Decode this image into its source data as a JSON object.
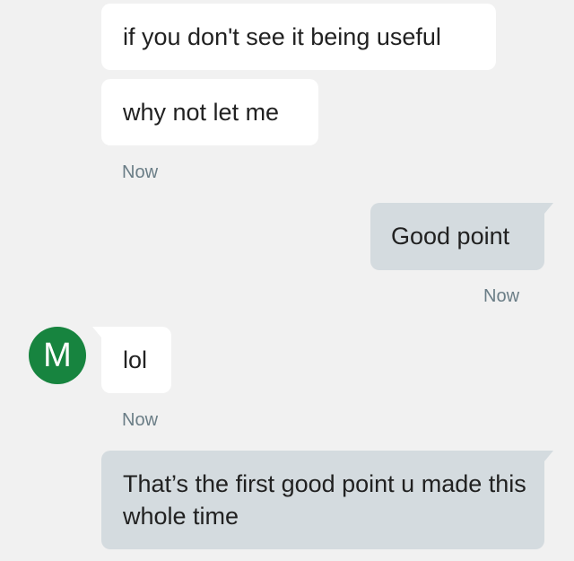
{
  "messages": [
    {
      "direction": "incoming",
      "text": "if you don't see it being useful"
    },
    {
      "direction": "incoming",
      "text": "why not let me"
    },
    {
      "direction": "incoming",
      "timestamp": "Now"
    },
    {
      "direction": "outgoing",
      "text": "Good point"
    },
    {
      "direction": "outgoing",
      "timestamp": "Now"
    },
    {
      "direction": "incoming",
      "sender_initial": "M",
      "text": "lol"
    },
    {
      "direction": "incoming",
      "timestamp": "Now"
    },
    {
      "direction": "outgoing",
      "text": "That’s the first good point u made this whole time"
    }
  ],
  "colors": {
    "background": "#f1f1f1",
    "incoming_bubble": "#ffffff",
    "outgoing_bubble": "#d4dbdf",
    "avatar": "#17843f",
    "timestamp": "#6a7d86"
  }
}
